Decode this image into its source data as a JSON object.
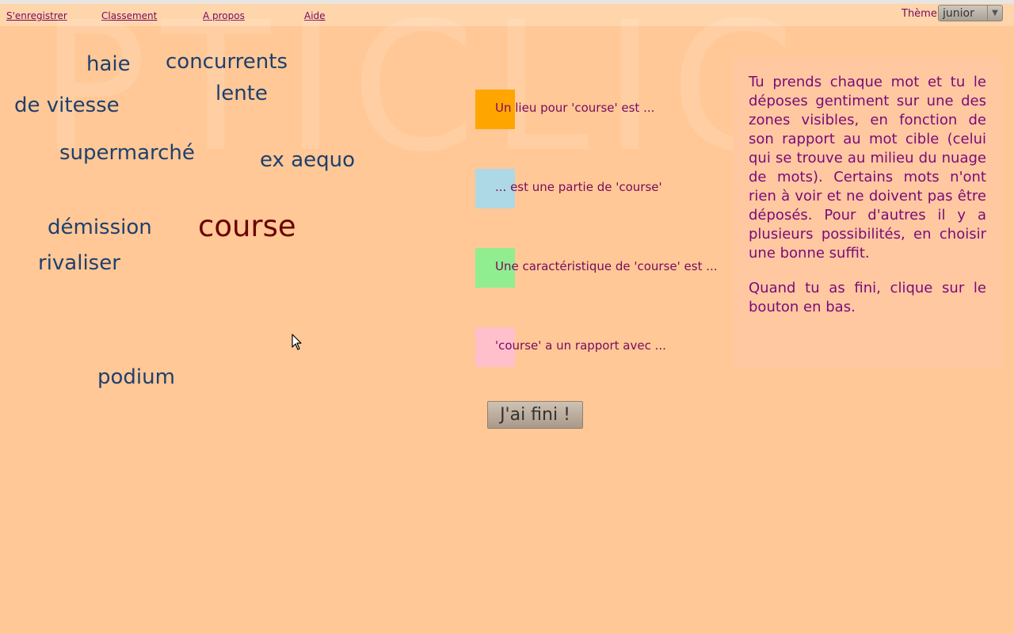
{
  "menu": {
    "register": "S'enregistrer",
    "ranking": "Classement",
    "about": "A propos",
    "help": "Aide"
  },
  "theme": {
    "label": "Thème",
    "selected": "junior"
  },
  "watermark": "PTICLIC",
  "target_word": "course",
  "words": [
    "haie",
    "concurrents",
    "de vitesse",
    "lente",
    "supermarché",
    "ex aequo",
    "démission",
    "rivaliser",
    "podium"
  ],
  "zones": [
    {
      "label": "Un lieu pour 'course' est ...",
      "color": "#ffa500"
    },
    {
      "label": "... est une partie de 'course'",
      "color": "#add8e6"
    },
    {
      "label": "Une caractéristique de 'course' est ...",
      "color": "#90ee90"
    },
    {
      "label": "'course' a un rapport avec ...",
      "color": "#ffc0cb"
    }
  ],
  "instructions": {
    "p1": "Tu prends chaque mot et tu le déposes gentiment sur une des zones visibles, en fonction de son rapport au mot cible (celui qui se trouve au milieu du nuage de mots). Certains mots n'ont rien à voir et ne doivent pas être déposés. Pour d'autres il y a plusieurs possibilités, en choisir une bonne suffit.",
    "p2": "Quand tu as fini, clique sur le bouton en bas."
  },
  "done_button": "J'ai fini !"
}
